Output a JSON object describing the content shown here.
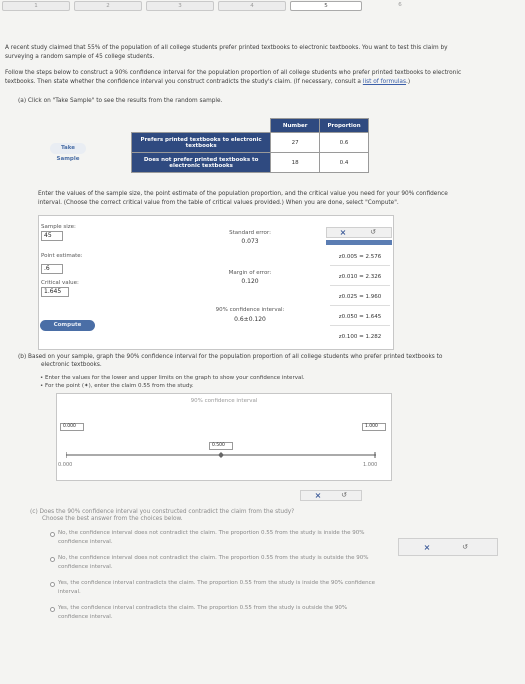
{
  "tabs": [
    "1",
    "2",
    "3",
    "4",
    "5",
    "6"
  ],
  "intro": {
    "line1": "A recent study claimed that 55% of the population of all college students prefer printed textbooks to electronic textbooks. You want to test this claim by",
    "line2": "surveying a random sample of 45 college students.",
    "line3": "Follow the steps below to construct a 90% confidence interval for the population proportion of all college students who prefer printed textbooks to electronic",
    "line4": "textbooks. Then state whether the confidence interval you construct contradicts the study's claim. (If necessary, consult a",
    "link": "list of formulas",
    "line4_end": ".)"
  },
  "part_a": {
    "prompt": "(a)   Click on \"Take Sample\" to see the results from the random sample.",
    "take_sample_label": "Take Sample",
    "table": {
      "headers": [
        "",
        "Number",
        "Proportion"
      ],
      "rows": [
        {
          "label": "Prefers printed textbooks to electronic textbooks",
          "number": "27",
          "proportion": "0.6"
        },
        {
          "label": "Does not prefer printed textbooks to electronic textbooks",
          "number": "18",
          "proportion": "0.4"
        }
      ]
    },
    "instructions_1": "Enter the values of the sample size, the point estimate of the population proportion, and the critical value you need for your 90% confidence",
    "instructions_2": "interval. (Choose the correct critical value from the table of critical values provided.) When you are done, select \"Compute\".",
    "sample_size_label": "Sample size:",
    "sample_size_value": "45",
    "point_estimate_label": "Point estimate:",
    "point_estimate_value": ".6",
    "critical_value_label": "Critical value:",
    "critical_value_value": "1.645",
    "compute_label": "Compute",
    "standard_error_label": "Standard error:",
    "standard_error_value": "0.073",
    "margin_label": "Margin of error:",
    "margin_value": "0.120",
    "interval_label": "90% confidence interval:",
    "interval_value": "0.6±0.120",
    "critical_values": [
      "z0.005 = 2.576",
      "z0.010 = 2.326",
      "z0.025 = 1.960",
      "z0.050 = 1.645",
      "z0.100 = 1.282"
    ]
  },
  "part_b": {
    "prompt_1": "(b)   Based on your sample, graph the 90% confidence interval for the population proportion of all college students who prefer printed textbooks to",
    "prompt_2": "electronic textbooks.",
    "bullet_1": "Enter the values for the lower and upper limits on the graph to show your confidence interval.",
    "bullet_2": "For the point (✦), enter the claim 0.55 from the study.",
    "graph_title": "90% confidence interval",
    "lower_box": "0.000",
    "upper_box": "1.000",
    "point_box": "0.500",
    "axis_min": "0.000",
    "axis_max": "1.000"
  },
  "part_c": {
    "prompt_1": "(c)   Does the 90% confidence interval you constructed contradict the claim from the study?",
    "prompt_2": "Choose the best answer from the choices below.",
    "options": [
      {
        "l1": "No, the confidence interval does not contradict the claim. The proportion 0.55 from the study is inside the 90%",
        "l2": "confidence interval."
      },
      {
        "l1": "No, the confidence interval does not contradict the claim. The proportion 0.55 from the study is outside the 90%",
        "l2": "confidence interval."
      },
      {
        "l1": "Yes, the confidence interval contradicts the claim. The proportion 0.55 from the study is inside the 90% confidence",
        "l2": "interval."
      },
      {
        "l1": "Yes, the confidence interval contradicts the claim. The proportion 0.55 from the study is outside the 90%",
        "l2": "confidence interval."
      }
    ]
  },
  "icons": {
    "close": "×",
    "undo": "↺"
  }
}
